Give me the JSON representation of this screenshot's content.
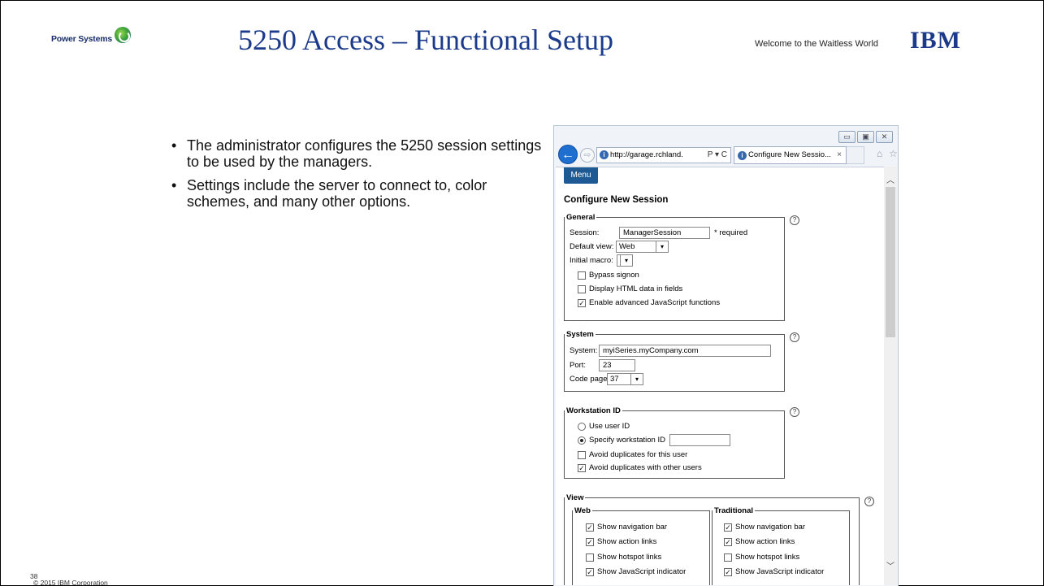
{
  "header": {
    "brand": "Power Systems",
    "title": "5250 Access – Functional Setup",
    "tagline": "Welcome to the Waitless World",
    "ibm_logo": "IBM"
  },
  "bullets": [
    "The administrator configures the 5250 session settings to be used by the managers.",
    "Settings include the server to connect to, color schemes, and many other options."
  ],
  "footer": {
    "page_number": "38",
    "copyright": "© 2015 IBM Corporation"
  },
  "browser": {
    "address": "http://garage.rchland.",
    "address_tools": "Ρ ▾ C",
    "tab_title": "Configure New Sessio...",
    "tab_close": "×",
    "window_controls": [
      "▭",
      "▣",
      "✕"
    ],
    "back_glyph": "←",
    "forward_glyph": "⇨",
    "home_glyph": "⌂",
    "star_glyph": "☆"
  },
  "page": {
    "menu_label": "Menu",
    "heading": "Configure New Session",
    "help_glyph": "?",
    "general": {
      "legend": "General",
      "session_label": "Session:",
      "session_value": "ManagerSession",
      "required_note": "* required",
      "default_view_label": "Default view:",
      "default_view_value": "Web",
      "initial_macro_label": "Initial macro:",
      "initial_macro_value": "",
      "checks": [
        {
          "label": "Bypass signon",
          "checked": false
        },
        {
          "label": "Display HTML data in fields",
          "checked": false
        },
        {
          "label": "Enable advanced JavaScript functions",
          "checked": true
        }
      ]
    },
    "system": {
      "legend": "System",
      "system_label": "System:",
      "system_value": "myiSeries.myCompany.com",
      "port_label": "Port:",
      "port_value": "23",
      "codepage_label": "Code page:",
      "codepage_value": "37"
    },
    "workstation": {
      "legend": "Workstation ID",
      "use_user_id": "Use user ID",
      "specify_id": "Specify workstation ID",
      "specify_value": "",
      "checks": [
        {
          "label": "Avoid duplicates for this user",
          "checked": false
        },
        {
          "label": "Avoid duplicates with other users",
          "checked": true
        }
      ]
    },
    "view": {
      "legend": "View",
      "web": {
        "legend": "Web",
        "checks": [
          {
            "label": "Show navigation bar",
            "checked": true
          },
          {
            "label": "Show action links",
            "checked": true
          },
          {
            "label": "Show hotspot links",
            "checked": false
          },
          {
            "label": "Show JavaScript indicator",
            "checked": true
          }
        ]
      },
      "traditional": {
        "legend": "Traditional",
        "checks": [
          {
            "label": "Show navigation bar",
            "checked": true
          },
          {
            "label": "Show action links",
            "checked": true
          },
          {
            "label": "Show hotspot links",
            "checked": false
          },
          {
            "label": "Show JavaScript indicator",
            "checked": true
          }
        ]
      }
    }
  },
  "colors": {
    "title_blue": "#1b3a8a",
    "menu_blue": "#1d5a94",
    "ie_back_blue": "#1f6fd1"
  }
}
